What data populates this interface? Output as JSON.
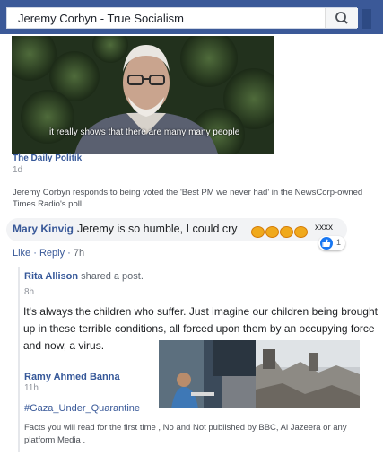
{
  "search": {
    "query": "Jeremy Corbyn - True Socialism",
    "icon": "search-icon"
  },
  "video": {
    "subtitle": "it really shows that there are many many people"
  },
  "post": {
    "source": "The Daily Politik",
    "time": "1d",
    "caption": "Jeremy Corbyn responds to being voted the 'Best PM we never had' in the NewsCorp-owned Times Radio's poll."
  },
  "comment": {
    "author": "Mary Kinvig",
    "text": "Jeremy is so humble, I could cry",
    "emoji": "fist-emoji",
    "emoji_count": 4,
    "tail": "xxxx",
    "reaction_count": "1",
    "like_label": "Like",
    "reply_label": "Reply",
    "time": "7h"
  },
  "shared_post": {
    "author": "Rita Allison",
    "action": "shared a post.",
    "time": "8h",
    "text": "It's always the children who suffer. Just imagine our children being brought up in these terrible conditions, all forced upon them by an occupying force and now, a virus.",
    "inner_author": "Ramy Ahmed Banna",
    "inner_time": "11h",
    "hashtag": "#Gaza_Under_Quarantine",
    "inner_text": "Facts you will read for the first time , No and Not published by BBC, Al Jazeera or any platform Media ."
  },
  "colors": {
    "header": "#3b5998",
    "link": "#365899",
    "like": "#1877f2"
  }
}
